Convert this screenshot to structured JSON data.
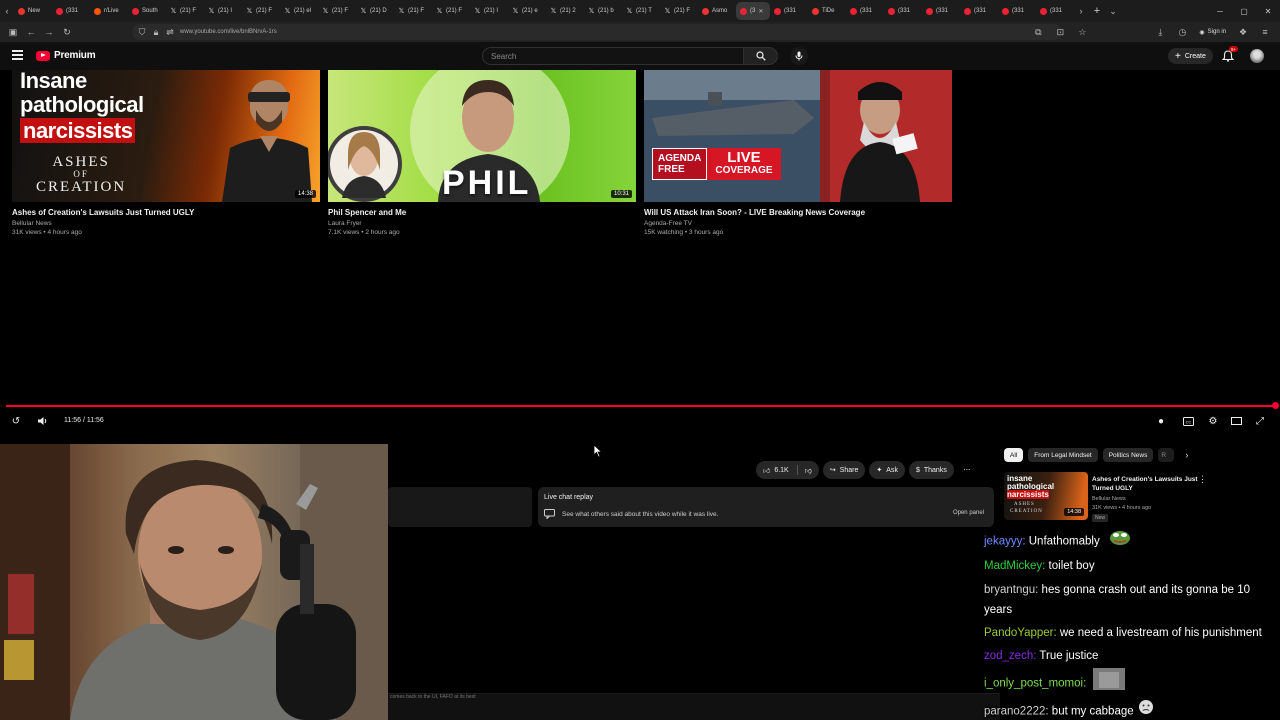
{
  "browser": {
    "tabs": [
      {
        "label": "New",
        "fav": "#e33"
      },
      {
        "label": "(331",
        "fav": "#e23"
      },
      {
        "label": "r/Live",
        "fav": "#f50"
      },
      {
        "label": "South",
        "fav": "#e23"
      },
      {
        "label": "(21) F",
        "fav": "x"
      },
      {
        "label": "(21) I",
        "fav": "x"
      },
      {
        "label": "(21) F",
        "fav": "x"
      },
      {
        "label": "(21) el",
        "fav": "x"
      },
      {
        "label": "(21) F",
        "fav": "x"
      },
      {
        "label": "(21) D",
        "fav": "x"
      },
      {
        "label": "(21) F",
        "fav": "x"
      },
      {
        "label": "(21) F",
        "fav": "x"
      },
      {
        "label": "(21) I",
        "fav": "x"
      },
      {
        "label": "(21) e",
        "fav": "x"
      },
      {
        "label": "(21) 2",
        "fav": "x"
      },
      {
        "label": "(21) b",
        "fav": "x"
      },
      {
        "label": "(21) T",
        "fav": "x"
      },
      {
        "label": "(21) F",
        "fav": "x"
      },
      {
        "label": "Asmo",
        "fav": "#e33"
      },
      {
        "label": "(3",
        "fav": "#e23",
        "active": true
      },
      {
        "label": "(331",
        "fav": "#e23"
      },
      {
        "label": "TiDe",
        "fav": "#e33"
      },
      {
        "label": "(331",
        "fav": "#e23"
      },
      {
        "label": "(331",
        "fav": "#e23"
      },
      {
        "label": "(331",
        "fav": "#e23"
      },
      {
        "label": "(331",
        "fav": "#e23"
      },
      {
        "label": "(331",
        "fav": "#e23"
      },
      {
        "label": "(331",
        "fav": "#e23"
      }
    ],
    "url": "www.youtube.com/live/bnlBNrvA-1rs",
    "signin_label": "Sign in"
  },
  "youtube": {
    "logo_label": "Premium",
    "search_placeholder": "Search",
    "create_label": "Create",
    "notif_badge": "9+"
  },
  "end_screen": [
    {
      "title": "Ashes of Creation's Lawsuits Just Turned UGLY",
      "channel": "Bellular News",
      "meta": "31K views • 4 hours ago",
      "duration": "14:38",
      "thumb_text": [
        "Insane",
        "pathological",
        "narcissists",
        "ASHES",
        "OF",
        "CREATION"
      ]
    },
    {
      "title": "Phil Spencer and Me",
      "channel": "Laura Fryer",
      "meta": "7.1K views • 2 hours ago",
      "duration": "10:31",
      "thumb_text": [
        "PHIL"
      ]
    },
    {
      "title": "Will US Attack Iran Soon? - LIVE Breaking News Coverage",
      "channel": "Agenda-Free TV",
      "meta": "15K watching • 3 hours ago",
      "thumb_text": [
        "AGENDA",
        "FREE",
        "LIVE",
        "COVERAGE"
      ]
    }
  ],
  "player": {
    "progress": 1.0,
    "timecode": "11:56 / 11:56"
  },
  "actions": {
    "like_count": "6.1K",
    "share_label": "Share",
    "ask_label": "Ask",
    "thanks_label": "Thanks"
  },
  "chat_replay": {
    "title": "Live chat replay",
    "description": "See what others said about this video while it was live.",
    "open_label": "Open panel"
  },
  "chips": [
    "All",
    "From Legal Mindset",
    "Politics News",
    "R"
  ],
  "recommendation": {
    "title": "Ashes of Creation's Lawsuits Just Turned UGLY",
    "channel": "Bellular News",
    "meta": "31K views • 4 hours ago",
    "badge": "New",
    "duration": "14:38",
    "thumb_text": [
      "insane",
      "pathological",
      "narcissists",
      "ASHES",
      "CREATION"
    ]
  },
  "stream_chat": [
    {
      "user": "jekayyy",
      "color": "#6a8cff",
      "text": "Unfathomably",
      "emote": "pepe"
    },
    {
      "user": "MadMickey",
      "color": "#2ecc40",
      "text": "toilet boy"
    },
    {
      "user": "bryantngu",
      "color": "#d0d0d0",
      "text": "hes gonna crash out and its gonna be 10 years"
    },
    {
      "user": "PandoYapper",
      "color": "#9acd32",
      "text": "we need a livestream of his punishment"
    },
    {
      "user": "zod_zech",
      "color": "#8a2be2",
      "text": "True justice"
    },
    {
      "user": "i_only_post_momoi",
      "color": "#7fdf4f",
      "text": "",
      "emote": "img"
    },
    {
      "user": "parano2222",
      "color": "#d0d0d0",
      "text": "but my cabbage",
      "emote": "sad"
    }
  ],
  "bottom_strip_text": "comes back to the UI, FAFO at its best"
}
